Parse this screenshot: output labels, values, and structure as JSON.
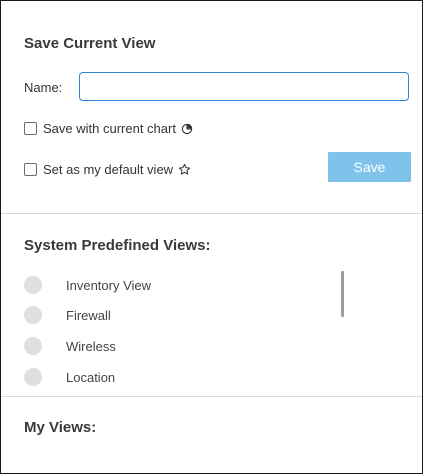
{
  "save_view": {
    "title": "Save Current View",
    "name_label": "Name:",
    "name_value": "",
    "name_placeholder": "",
    "save_with_chart_label": "Save with current chart",
    "save_with_chart_checked": false,
    "default_view_label": "Set as my default view",
    "default_view_checked": false,
    "save_button_label": "Save"
  },
  "system_views": {
    "title": "System Predefined Views:",
    "items": [
      {
        "label": "Inventory View"
      },
      {
        "label": "Firewall"
      },
      {
        "label": "Wireless"
      },
      {
        "label": "Location"
      }
    ]
  },
  "my_views": {
    "title": "My Views:"
  },
  "icons": {
    "chart": "pie-chart-icon",
    "default": "star-outline-icon"
  },
  "colors": {
    "accent": "#2f86d4",
    "save_button": "#7fc3ea",
    "radio": "#dedfe2",
    "divider": "#d9d9d9"
  }
}
